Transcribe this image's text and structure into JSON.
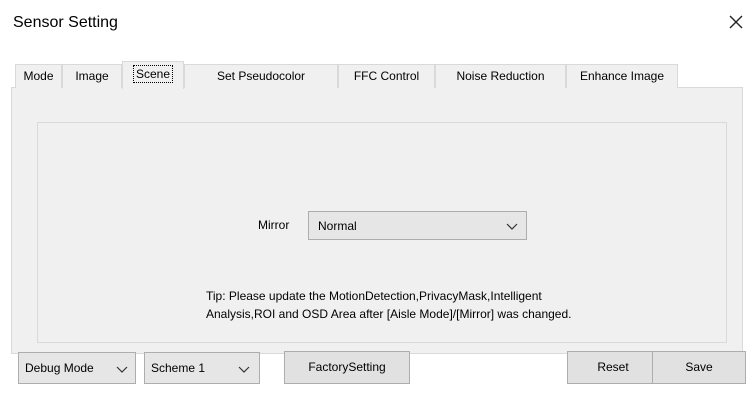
{
  "window": {
    "title": "Sensor Setting",
    "close_icon": "close-icon"
  },
  "tabs": [
    {
      "label": "Mode",
      "active": false
    },
    {
      "label": "Image",
      "active": false
    },
    {
      "label": "Scene",
      "active": true
    },
    {
      "label": "Set Pseudocolor",
      "active": false
    },
    {
      "label": "FFC Control",
      "active": false
    },
    {
      "label": "Noise Reduction",
      "active": false
    },
    {
      "label": "Enhance Image",
      "active": false
    }
  ],
  "scene": {
    "mirror_label": "Mirror",
    "mirror_value": "Normal",
    "tip_line1": "Tip: Please update the MotionDetection,PrivacyMask,Intelligent",
    "tip_line2": "Analysis,ROI and OSD Area after [Aisle Mode]/[Mirror] was changed."
  },
  "footer": {
    "mode_select": "Debug Mode",
    "scheme_select": "Scheme 1",
    "factory_button": "FactorySetting",
    "reset_button": "Reset",
    "save_button": "Save"
  },
  "colors": {
    "panel_bg": "#f0f0f0",
    "border": "#d9d9d9",
    "control_bg": "#e6e6e6"
  }
}
